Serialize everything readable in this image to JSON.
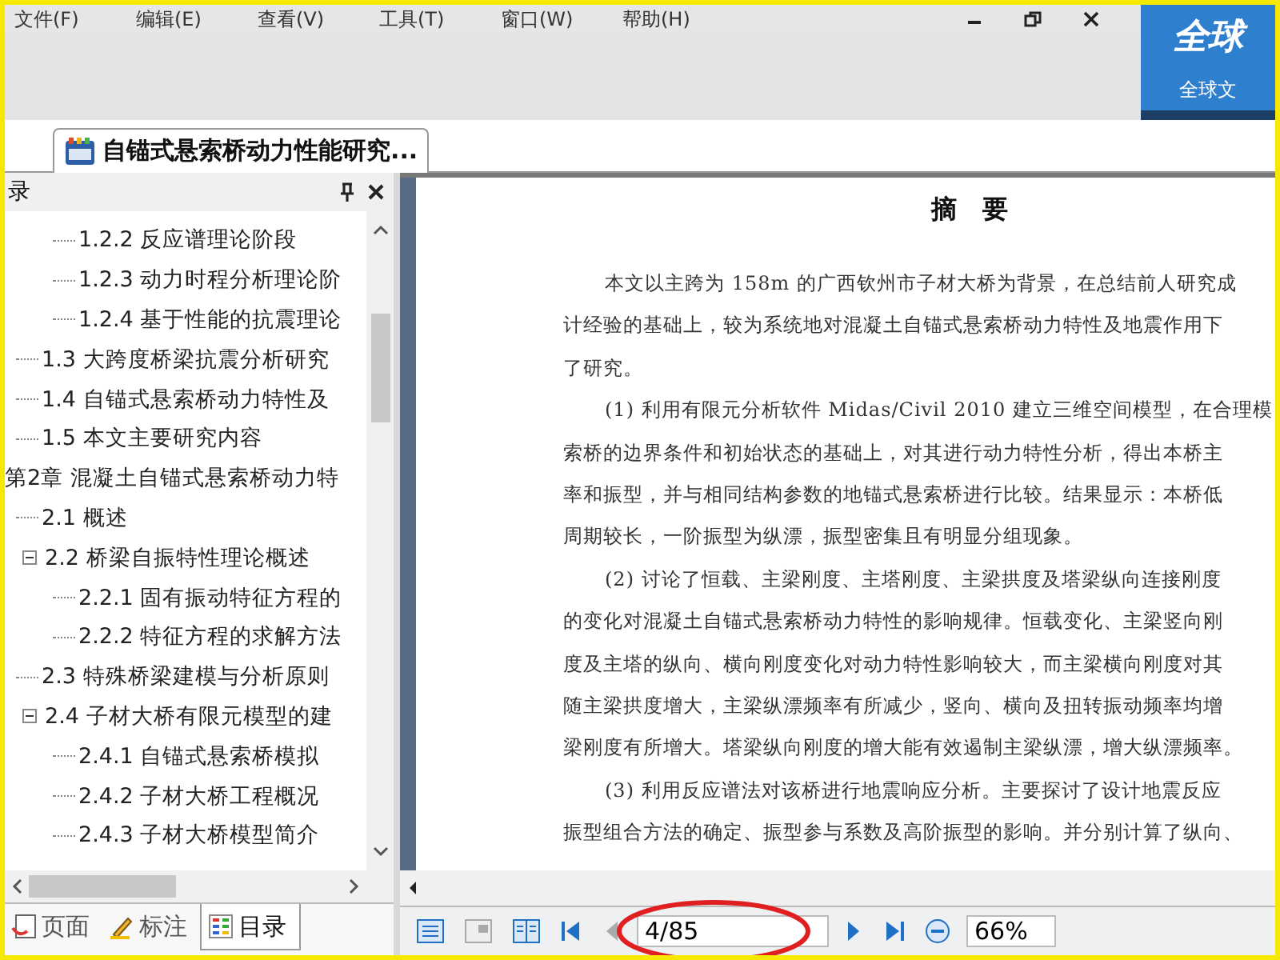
{
  "menu": [
    {
      "label": "文件(F)"
    },
    {
      "label": "编辑(E)"
    },
    {
      "label": "查看(V)"
    },
    {
      "label": "工具(T)"
    },
    {
      "label": "窗口(W)"
    },
    {
      "label": "帮助(H)"
    }
  ],
  "logo": {
    "big": "全球",
    "small": "全球文"
  },
  "document_tab": {
    "label": "自锚式悬索桥动力性能研究...",
    "selected": true
  },
  "outline_panel": {
    "title": "录",
    "tree": [
      {
        "children": [
          {
            "children": [
              {
                "label": "1.2.2 反应谱理论阶段"
              },
              {
                "label": "1.2.3 动力时程分析理论阶"
              },
              {
                "label": "1.2.4 基于性能的抗震理论"
              }
            ]
          },
          {
            "label": "1.3 大跨度桥梁抗震分析研究"
          },
          {
            "label": "1.4 自锚式悬索桥动力特性及"
          },
          {
            "label": "1.5 本文主要研究内容"
          }
        ]
      },
      {
        "label": "第2章 混凝土自锚式悬索桥动力特",
        "children": [
          {
            "label": "2.1 概述"
          },
          {
            "label": "2.2 桥梁自振特性理论概述",
            "expanded": true,
            "children": [
              {
                "label": "2.2.1 固有振动特征方程的"
              },
              {
                "label": "2.2.2 特征方程的求解方法"
              }
            ]
          },
          {
            "label": "2.3 特殊桥梁建模与分析原则"
          },
          {
            "label": "2.4 子材大桥有限元模型的建",
            "expanded": true,
            "children": [
              {
                "label": "2.4.1 自锚式悬索桥模拟"
              },
              {
                "label": "2.4.2 子材大桥工程概况"
              },
              {
                "label": "2.4.3 子材大桥模型简介"
              }
            ]
          }
        ]
      }
    ],
    "tabs": [
      {
        "kind": "page",
        "label": "页面",
        "selected": false
      },
      {
        "kind": "annotation",
        "label": "标注",
        "selected": false
      },
      {
        "kind": "outline",
        "label": "目录",
        "selected": true
      }
    ]
  },
  "document": {
    "title": "摘　要",
    "paragraphs": [
      {
        "lines": [
          "本文以主跨为 158m 的广西钦州市子材大桥为背景，在总结前人研究成",
          "计经验的基础上，较为系统地对混凝土自锚式悬索桥动力特性及地震作用下",
          "了研究。"
        ]
      },
      {
        "lines": [
          "(1) 利用有限元分析软件 Midas/Civil 2010 建立三维空间模型，在合理模",
          "索桥的边界条件和初始状态的基础上，对其进行动力特性分析，得出本桥主",
          "率和振型，并与相同结构参数的地锚式悬索桥进行比较。结果显示：本桥低",
          "周期较长，一阶振型为纵漂，振型密集且有明显分组现象。"
        ]
      },
      {
        "lines": [
          "(2) 讨论了恒载、主梁刚度、主塔刚度、主梁拱度及塔梁纵向连接刚度",
          "的变化对混凝土自锚式悬索桥动力特性的影响规律。恒载变化、主梁竖向刚",
          "度及主塔的纵向、横向刚度变化对动力特性影响较大，而主梁横向刚度对其",
          "随主梁拱度增大，主梁纵漂频率有所减少，竖向、横向及扭转振动频率均增",
          "梁刚度有所增大。塔梁纵向刚度的增大能有效遏制主梁纵漂，增大纵漂频率。"
        ]
      },
      {
        "lines": [
          "(3) 利用反应谱法对该桥进行地震响应分析。主要探讨了设计地震反应",
          "振型组合方法的确定、振型参与系数及高阶振型的影响。并分别计算了纵向、"
        ]
      }
    ]
  },
  "toolbar": {
    "left_buttons": [
      {
        "kind": "single-page",
        "disabled": false
      },
      {
        "kind": "facing-pages",
        "disabled": true
      },
      {
        "kind": "book",
        "disabled": false
      },
      {
        "kind": "first",
        "disabled": false
      },
      {
        "kind": "prev",
        "disabled": true
      }
    ],
    "page": "4/85",
    "right_buttons": [
      {
        "kind": "next",
        "disabled": false
      },
      {
        "kind": "last",
        "disabled": false
      },
      {
        "kind": "zoom-out",
        "disabled": false
      }
    ],
    "zoom": "66%"
  }
}
